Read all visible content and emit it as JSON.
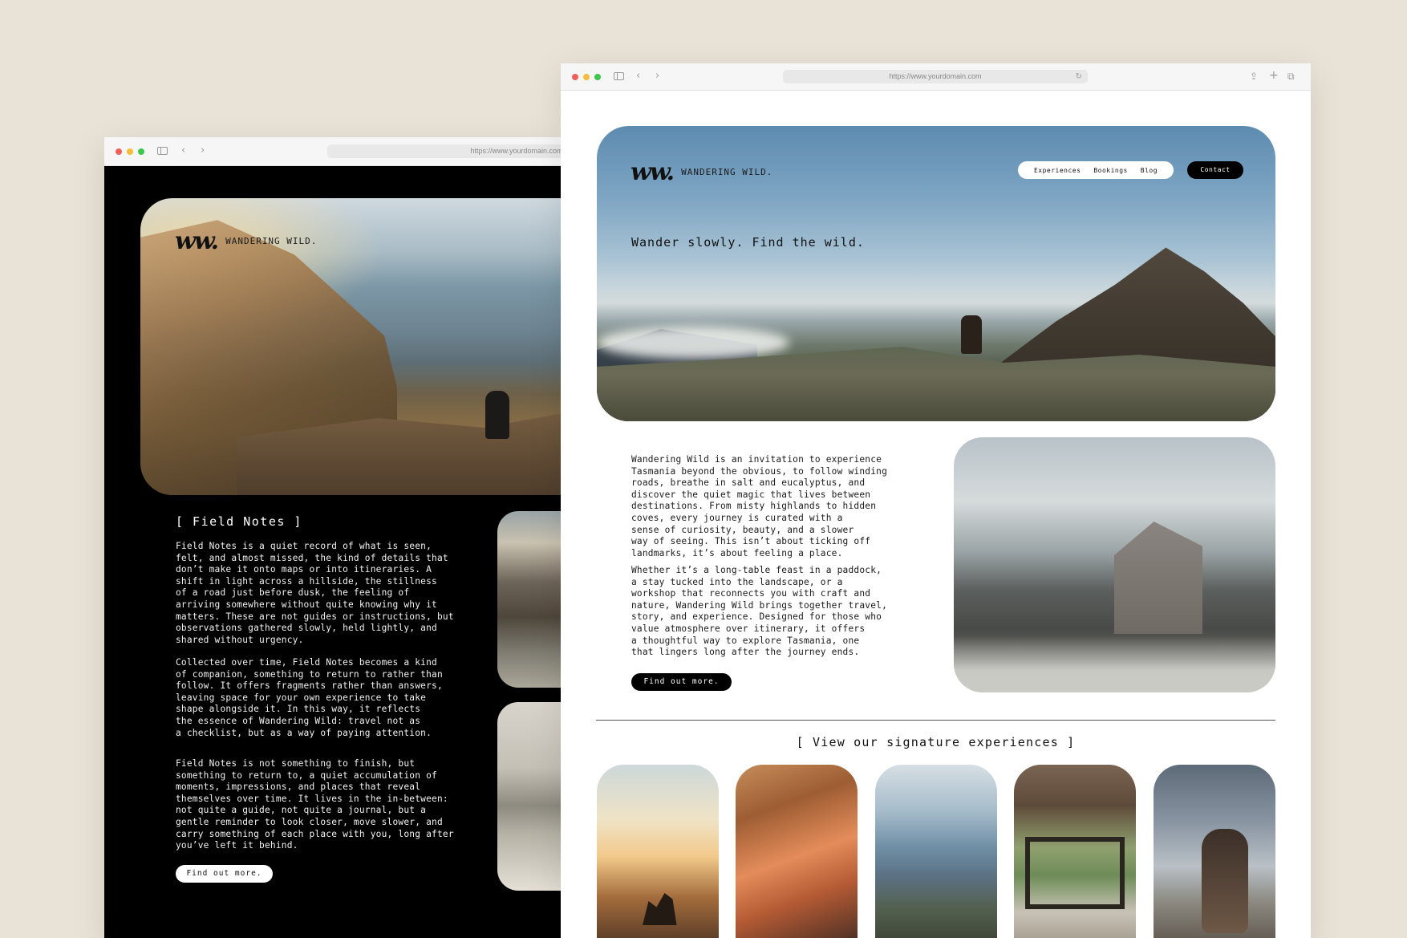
{
  "left_window": {
    "url": "https://www.yourdomain.com",
    "brand": {
      "mark": "ww.",
      "name": "WANDERING WILD."
    },
    "section_title": "[ Field Notes ]",
    "paragraphs": [
      "Field Notes is a quiet record of what is seen,\nfelt, and almost missed, the kind of details that\ndon’t make it onto maps or into itineraries. A\nshift in light across a hillside, the stillness\nof a road just before dusk, the feeling of\narriving somewhere without quite knowing why it\nmatters. These are not guides or instructions, but\nobservations gathered slowly, held lightly, and\nshared without urgency.",
      "Collected over time, Field Notes becomes a kind\nof companion, something to return to rather than\nfollow. It offers fragments rather than answers,\nleaving space for your own experience to take\nshape alongside it. In this way, it reflects\nthe essence of Wandering Wild: travel not as\na checklist, but as a way of paying attention.",
      "Field Notes is not something to finish, but\nsomething to return to, a quiet accumulation of\nmoments, impressions, and places that reveal\nthemselves over time. It lives in the in-between:\nnot quite a guide, not quite a journal, but a\ngentle reminder to look closer, move slower, and\ncarry something of each place with you, long after\nyou’ve left it behind."
    ],
    "button_label": "Find out more."
  },
  "right_window": {
    "url": "https://www.yourdomain.com",
    "brand": {
      "mark": "ww.",
      "name": "WANDERING WILD."
    },
    "nav": [
      "Experiences",
      "Bookings",
      "Blog"
    ],
    "contact_label": "Contact",
    "tagline": "Wander slowly. Find the wild.",
    "paragraphs": [
      "Wandering Wild is an invitation to experience\nTasmania beyond the obvious, to follow winding\nroads, breathe in salt and eucalyptus, and\ndiscover the quiet magic that lives between\ndestinations. From misty highlands to hidden\ncoves, every journey is curated with a\nsense of curiosity, beauty, and a slower\nway of seeing. This isn’t about ticking off\nlandmarks, it’s about feeling a place.",
      "Whether it’s a long-table feast in a paddock,\na stay tucked into the landscape, or a\nworkshop that reconnects you with craft and\nnature, Wandering Wild brings together travel,\nstory, and experience. Designed for those who\nvalue atmosphere over itinerary, it offers\na thoughtful way to explore Tasmania, one\nthat lingers long after the journey ends."
    ],
    "button_label": "Find out more.",
    "signature_heading": "[ View our signature experiences ]"
  },
  "colors": {
    "background": "#e9e2d6",
    "dark_panel": "#000000",
    "light_panel": "#ffffff",
    "traffic_red": "#f06058",
    "traffic_yellow": "#f4bd3e",
    "traffic_green": "#3fc64d"
  },
  "icons": {
    "back": "‹",
    "forward": "›",
    "reload": "↻",
    "share": "⇪",
    "new_tab": "+",
    "tabs": "⧉"
  }
}
